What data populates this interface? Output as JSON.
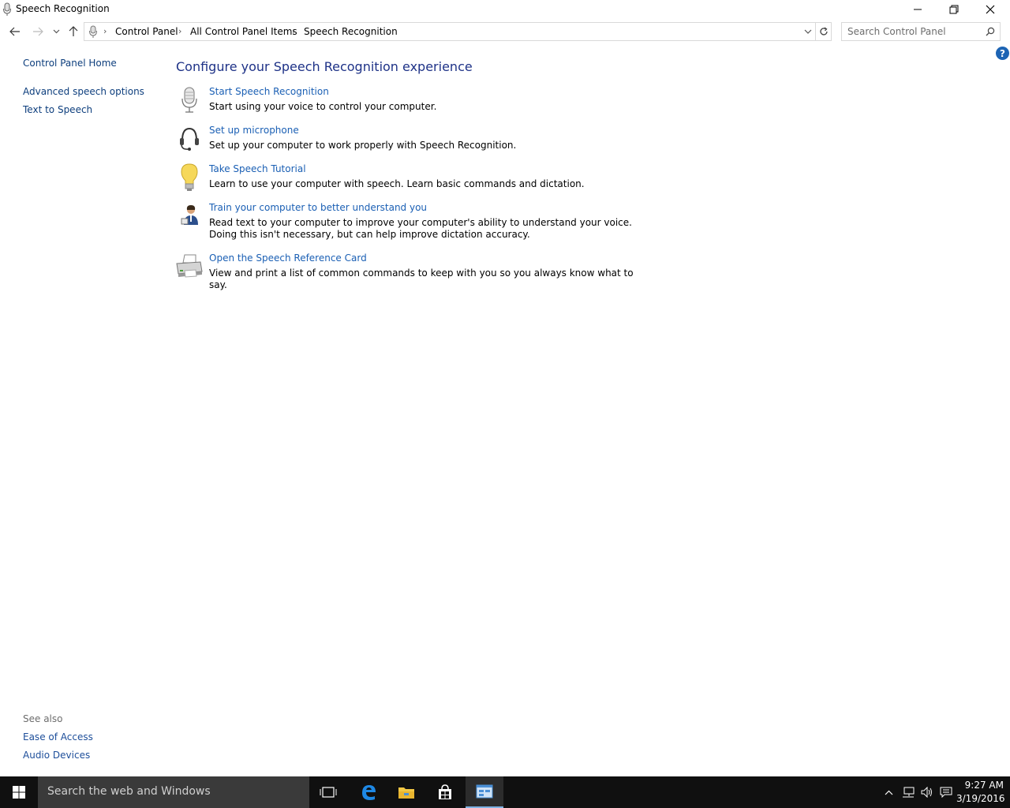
{
  "window": {
    "title": "Speech Recognition",
    "icon": "microphone-icon"
  },
  "address": {
    "breadcrumbs": [
      "Control Panel",
      "All Control Panel Items",
      "Speech Recognition"
    ],
    "search_placeholder": "Search Control Panel"
  },
  "sidebar": {
    "home": "Control Panel Home",
    "links": [
      "Advanced speech options",
      "Text to Speech"
    ],
    "see_also_label": "See also",
    "see_also": [
      "Ease of Access",
      "Audio Devices"
    ]
  },
  "main": {
    "heading": "Configure your Speech Recognition experience",
    "tasks": [
      {
        "title": "Start Speech Recognition",
        "description": "Start using your voice to control your computer.",
        "icon": "microphone-icon"
      },
      {
        "title": "Set up microphone",
        "description": "Set up your computer to work properly with Speech Recognition.",
        "icon": "headset-icon"
      },
      {
        "title": "Take Speech Tutorial",
        "description": "Learn to use your computer with speech.  Learn basic commands and dictation.",
        "icon": "lightbulb-icon"
      },
      {
        "title": "Train your computer to better understand you",
        "description": "Read text to your computer to improve your computer's ability to understand your voice.  Doing this isn't necessary, but can help improve dictation accuracy.",
        "icon": "user-training-icon"
      },
      {
        "title": "Open the Speech Reference Card",
        "description": "View and print a list of common commands to keep with you so you always know what to say.",
        "icon": "printer-icon"
      }
    ]
  },
  "taskbar": {
    "search_placeholder": "Search the web and Windows",
    "time": "9:27 AM",
    "date": "3/19/2016"
  },
  "colors": {
    "link": "#1a5fb4",
    "heading": "#1e3287",
    "taskbar": "#101010",
    "help": "#1d64b4"
  }
}
